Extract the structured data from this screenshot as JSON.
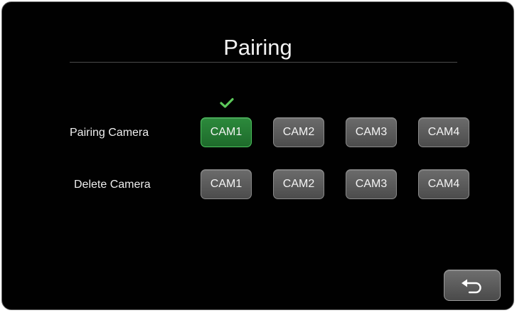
{
  "title": "Pairing",
  "pairing_row": {
    "label": "Pairing Camera",
    "buttons": [
      "CAM1",
      "CAM2",
      "CAM3",
      "CAM4"
    ],
    "active_index": 0
  },
  "delete_row": {
    "label": "Delete Camera",
    "buttons": [
      "CAM1",
      "CAM2",
      "CAM3",
      "CAM4"
    ]
  },
  "icons": {
    "paired": "checkmark-icon",
    "back": "back-arrow-icon"
  },
  "colors": {
    "background": "#010101",
    "active_button": "#2c8a3c",
    "checkmark": "#5cc85a",
    "button": "#5a5a5a"
  }
}
